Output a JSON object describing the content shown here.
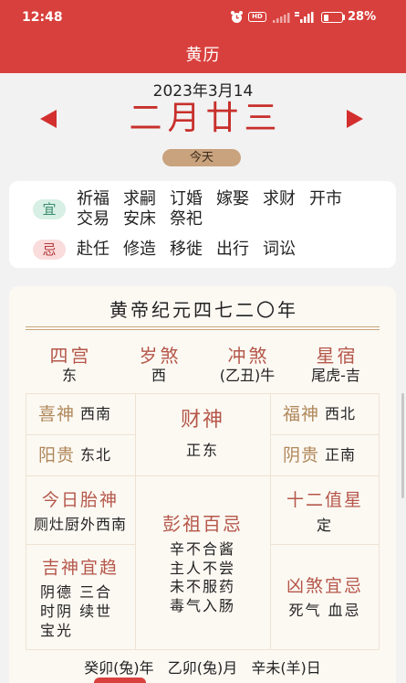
{
  "status_bar": {
    "time": "12:48",
    "hd_badge": "HD",
    "battery_text": "28%",
    "battery_level": 0.28,
    "icons": [
      "alarm-icon",
      "signal-icon",
      "signal-icon",
      "battery-icon"
    ]
  },
  "header": {
    "title": "黄历"
  },
  "date_nav": {
    "solar_date": "2023年3月14",
    "lunar_date": "二月廿三",
    "today_label": "今天",
    "prev_icon": "arrow-left-icon",
    "next_icon": "arrow-right-icon"
  },
  "yi_ji": {
    "yi": {
      "badge": "宜",
      "items": [
        "祈福",
        "求嗣",
        "订婚",
        "嫁娶",
        "求财",
        "开市",
        "交易",
        "安床",
        "祭祀"
      ]
    },
    "ji": {
      "badge": "忌",
      "items": [
        "赴任",
        "修造",
        "移徙",
        "出行",
        "词讼"
      ]
    }
  },
  "almanac": {
    "era_title": "黄帝纪元四七二〇年",
    "summary": [
      {
        "label": "四宫",
        "value": "东"
      },
      {
        "label": "岁煞",
        "value": "西"
      },
      {
        "label": "冲煞",
        "value": "(乙丑)牛"
      },
      {
        "label": "星宿",
        "value": "尾虎-吉"
      }
    ],
    "xi_shen": {
      "label": "喜神",
      "value": "西南"
    },
    "yang_gui": {
      "label": "阳贵",
      "value": "东北"
    },
    "cai_shen": {
      "label": "财神",
      "value": "正东"
    },
    "fu_shen": {
      "label": "福神",
      "value": "西北"
    },
    "yin_gui": {
      "label": "阴贵",
      "value": "正南"
    },
    "tai_shen": {
      "label": "今日胎神",
      "value": "厕灶厨外西南"
    },
    "pengzu": {
      "label": "彭祖百忌",
      "lines": [
        "辛不合酱",
        "主人不尝",
        "未不服药",
        "毒气入肠"
      ]
    },
    "zhi_xing": {
      "label": "十二值星",
      "value": "定"
    },
    "ji_shen": {
      "label": "吉神宜趋",
      "lines": [
        "阴德 三合",
        "时阴 续世",
        "宝光"
      ]
    },
    "xiong_sha": {
      "label": "凶煞宜忌",
      "lines": [
        "死气 血忌"
      ]
    },
    "ganzhi": "癸卯(兔)年 乙卯(兔)月 辛未(羊)日"
  },
  "colors": {
    "page_bg": "#f2f2f2",
    "header_red": "#d8403d",
    "lunar_red": "#c8302c",
    "arrow_red": "#d32f2f",
    "today_pill": "#c9a27e",
    "yi_badge_bg": "#d7efe4",
    "ji_badge_bg": "#fadcdc",
    "card_bg": "#fcf9f3",
    "rule": "#c8a57a",
    "grid_line": "#eee3d2",
    "label_brown": "#b5574a",
    "label_tan": "#b0875a"
  }
}
